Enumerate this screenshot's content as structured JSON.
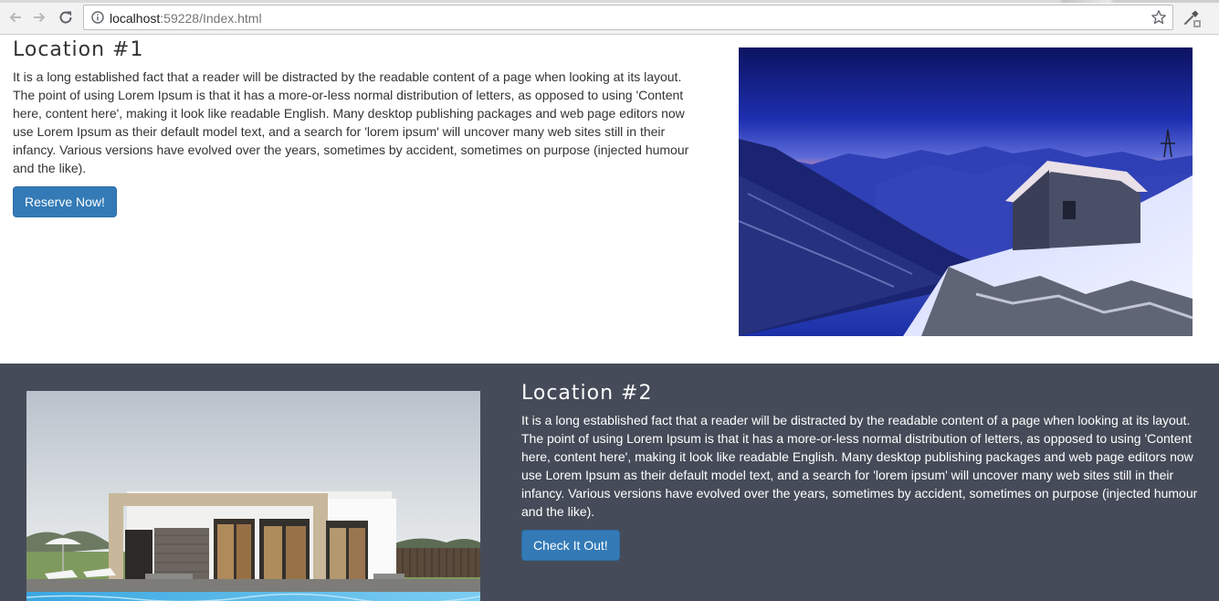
{
  "browser": {
    "url_host": "localhost",
    "url_rest": ":59228/Index.html",
    "icons": {
      "back": "back-arrow-icon",
      "forward": "forward-arrow-icon",
      "reload": "reload-icon",
      "info": "info-icon",
      "bookmark": "star-icon",
      "extension": "eyedropper-icon"
    }
  },
  "location1": {
    "title": "Location #1",
    "text": "It is a long established fact that a reader will be distracted by the readable content of a page when looking at its layout. The point of using Lorem Ipsum is that it has a more-or-less normal distribution of letters, as opposed to using 'Content here, content here', making it look like readable English. Many desktop publishing packages and web page editors now use Lorem Ipsum as their default model text, and a search for 'lorem ipsum' will uncover many web sites still in their infancy. Various versions have evolved over the years, sometimes by accident, sometimes on purpose (injected humour and the like).",
    "button_label": "Reserve Now!"
  },
  "location2": {
    "title": "Location #2",
    "text": "It is a long established fact that a reader will be distracted by the readable content of a page when looking at its layout. The point of using Lorem Ipsum is that it has a more-or-less normal distribution of letters, as opposed to using 'Content here, content here', making it look like readable English. Many desktop publishing packages and web page editors now use Lorem Ipsum as their default model text, and a search for 'lorem ipsum' will uncover many web sites still in their infancy. Various versions have evolved over the years, sometimes by accident, sometimes on purpose (injected humour and the like).",
    "button_label": "Check It Out!"
  },
  "colors": {
    "button_bg": "#337ab7",
    "section2_bg": "#454b58",
    "text_dark": "#333333",
    "text_light": "#ffffff"
  }
}
